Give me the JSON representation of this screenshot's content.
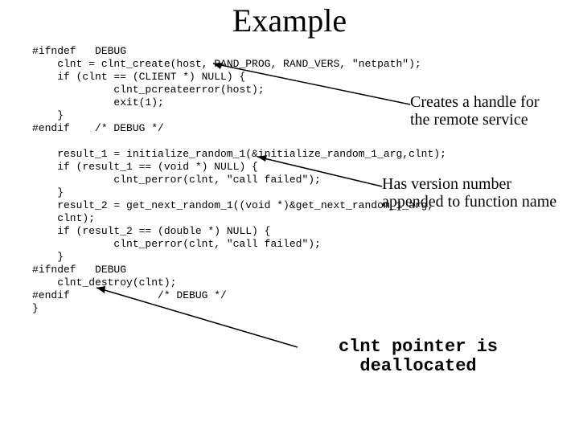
{
  "title": "Example",
  "code": "#ifndef   DEBUG\n    clnt = clnt_create(host, RAND_PROG, RAND_VERS, \"netpath\");\n    if (clnt == (CLIENT *) NULL) {\n             clnt_pcreateerror(host);\n             exit(1);\n    }\n#endif    /* DEBUG */\n\n    result_1 = initialize_random_1(&initialize_random_1_arg,clnt);\n    if (result_1 == (void *) NULL) {\n             clnt_perror(clnt, \"call failed\");\n    }\n    result_2 = get_next_random_1((void *)&get_next_random_1_arg,\n    clnt);\n    if (result_2 == (double *) NULL) {\n             clnt_perror(clnt, \"call failed\");\n    }\n#ifndef   DEBUG\n    clnt_destroy(clnt);\n#endif              /* DEBUG */\n}",
  "annotation1_line1": "Creates a handle for",
  "annotation1_line2": "the remote service",
  "annotation2_line1": "Has version number",
  "annotation2_line2": "appended to function name",
  "annotation3_line1": "clnt pointer is",
  "annotation3_line2": "deallocated"
}
